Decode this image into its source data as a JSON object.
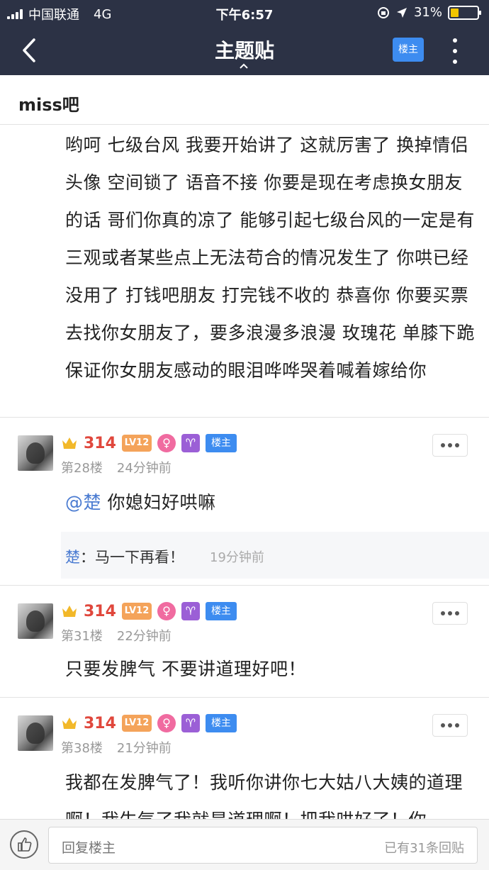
{
  "status": {
    "carrier": "中国联通",
    "network": "4G",
    "time": "下午6:57",
    "battery": "31%",
    "battery_level": 0.31
  },
  "nav": {
    "title": "主题贴",
    "op_button": "楼主"
  },
  "forum_name": "miss吧",
  "main_post": "哟呵 七级台风 我要开始讲了 这就厉害了 换掉情侣头像 空间锁了 语音不接 你要是现在考虑换女朋友的话 哥们你真的凉了 能够引起七级台风的一定是有三观或者某些点上无法苟合的情况发生了 你哄已经没用了 打钱吧朋友 打完钱不收的 恭喜你 你要买票去找你女朋友了，要多浪漫多浪漫 玫瑰花 单膝下跪 保证你女朋友感动的眼泪哗哗哭着喊着嫁给你",
  "floors": [
    {
      "username": "314",
      "level": "LV12",
      "gender": "♀",
      "zodiac": "♈",
      "tag": "楼主",
      "floor": "第28楼",
      "time": "24分钟前",
      "mention": "@楚",
      "text": " 你媳妇好哄嘛",
      "reply": {
        "name": "楚",
        "sep": "：",
        "text": "马一下再看！",
        "time": "19分钟前"
      }
    },
    {
      "username": "314",
      "level": "LV12",
      "gender": "♀",
      "zodiac": "♈",
      "tag": "楼主",
      "floor": "第31楼",
      "time": "22分钟前",
      "text": "只要发脾气 不要讲道理好吧！"
    },
    {
      "username": "314",
      "level": "LV12",
      "gender": "♀",
      "zodiac": "♈",
      "tag": "楼主",
      "floor": "第38楼",
      "time": "21分钟前",
      "text": "我都在发脾气了！我听你讲你七大姑八大姨的道理啊！我生气了我就是道理啊！把我哄好了！你"
    }
  ],
  "bottom": {
    "placeholder": "回复楼主",
    "count": "已有31条回贴"
  }
}
